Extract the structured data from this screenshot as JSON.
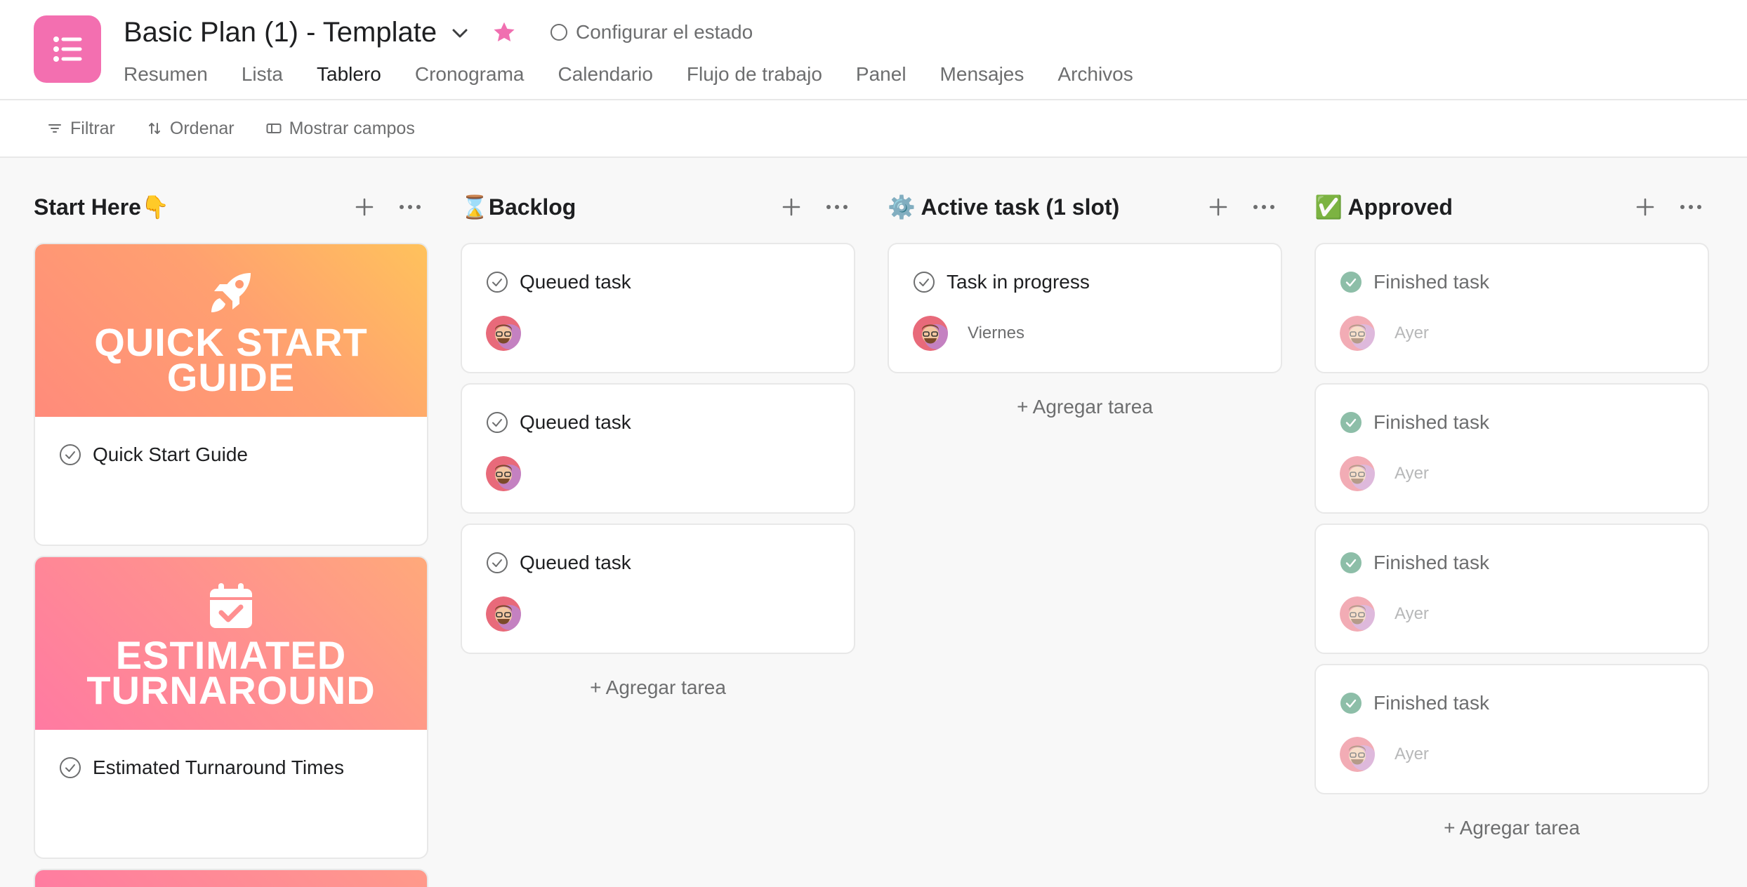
{
  "header": {
    "title": "Basic Plan (1) - Template",
    "status_label": "Configurar el estado",
    "tabs": [
      "Resumen",
      "Lista",
      "Tablero",
      "Cronograma",
      "Calendario",
      "Flujo de trabajo",
      "Panel",
      "Mensajes",
      "Archivos"
    ],
    "active_tab": "Tablero"
  },
  "toolbar": {
    "filter": "Filtrar",
    "sort": "Ordenar",
    "fields": "Mostrar campos"
  },
  "columns": [
    {
      "title": "Start Here👇",
      "cards": [
        {
          "cover_title": "QUICK START\nGUIDE",
          "cover_icon": "rocket-icon",
          "title": "Quick Start Guide"
        },
        {
          "cover_title": "ESTIMATED\nTURNAROUND",
          "cover_icon": "calendar-check-icon",
          "title": "Estimated Turnaround Times"
        }
      ]
    },
    {
      "title": "⌛Backlog",
      "cards": [
        {
          "title": "Queued task",
          "due": ""
        },
        {
          "title": "Queued task",
          "due": ""
        },
        {
          "title": "Queued task",
          "due": ""
        }
      ],
      "add_label": "+ Agregar tarea"
    },
    {
      "title": "⚙️ Active task (1 slot)",
      "cards": [
        {
          "title": "Task in progress",
          "due": "Viernes"
        }
      ],
      "add_label": "+ Agregar tarea"
    },
    {
      "title": "✅ Approved",
      "cards": [
        {
          "title": "Finished task",
          "due": "Ayer"
        },
        {
          "title": "Finished task",
          "due": "Ayer"
        },
        {
          "title": "Finished task",
          "due": "Ayer"
        },
        {
          "title": "Finished task",
          "due": "Ayer"
        }
      ],
      "add_label": "+ Agregar tarea"
    }
  ],
  "colors": {
    "brand_pink": "#f36fb0",
    "complete_green": "#5da283",
    "cover_orange_gradient": [
      "#ff8b7b",
      "#ffc25c"
    ],
    "cover_pink_gradient": [
      "#ff7aa2",
      "#ffa07a"
    ]
  }
}
